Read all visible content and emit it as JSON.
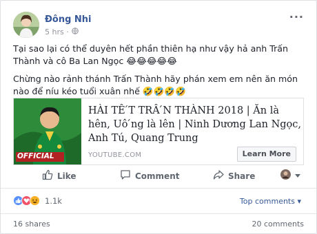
{
  "post": {
    "author": "Đông Nhi",
    "time": "5 hrs ·",
    "menu": "···",
    "paragraphs": [
      "Tại sao lại có thể duyên hết phần thiên hạ như vậy hả anh Trấn Thành và cô Ba Lan Ngọc 😂😂😂😂😂",
      "Chừng nào rảnh thánh Trấn Thành hãy phán xem em nên ăn món nào để níu kéo tuổi xuân nhế 🤣🤣🤣🤣"
    ]
  },
  "link": {
    "title": "HÀI TÊ ́T TRÂ ́N THÀNH 2018 | Ăn là hên, Uô ́ng là lên | Ninh Dương Lan Ngọc, Anh Tú, Quang Trung",
    "domain": "YOUTUBE.COM",
    "button": "Learn More",
    "thumb_badge": "OFFICIAL"
  },
  "actions": {
    "like": "Like",
    "comment": "Comment",
    "share": "Share"
  },
  "reactions": {
    "count": "1.1k",
    "sort": "Top comments ▾"
  },
  "footer": {
    "shares": "16 shares",
    "comments": "20 comments"
  },
  "colors": {
    "link_blue": "#365899",
    "like_blue": "#5890ff",
    "love_red": "#f25268",
    "haha_yellow": "#f7b125",
    "thumb_green": "#1e7a2c"
  }
}
